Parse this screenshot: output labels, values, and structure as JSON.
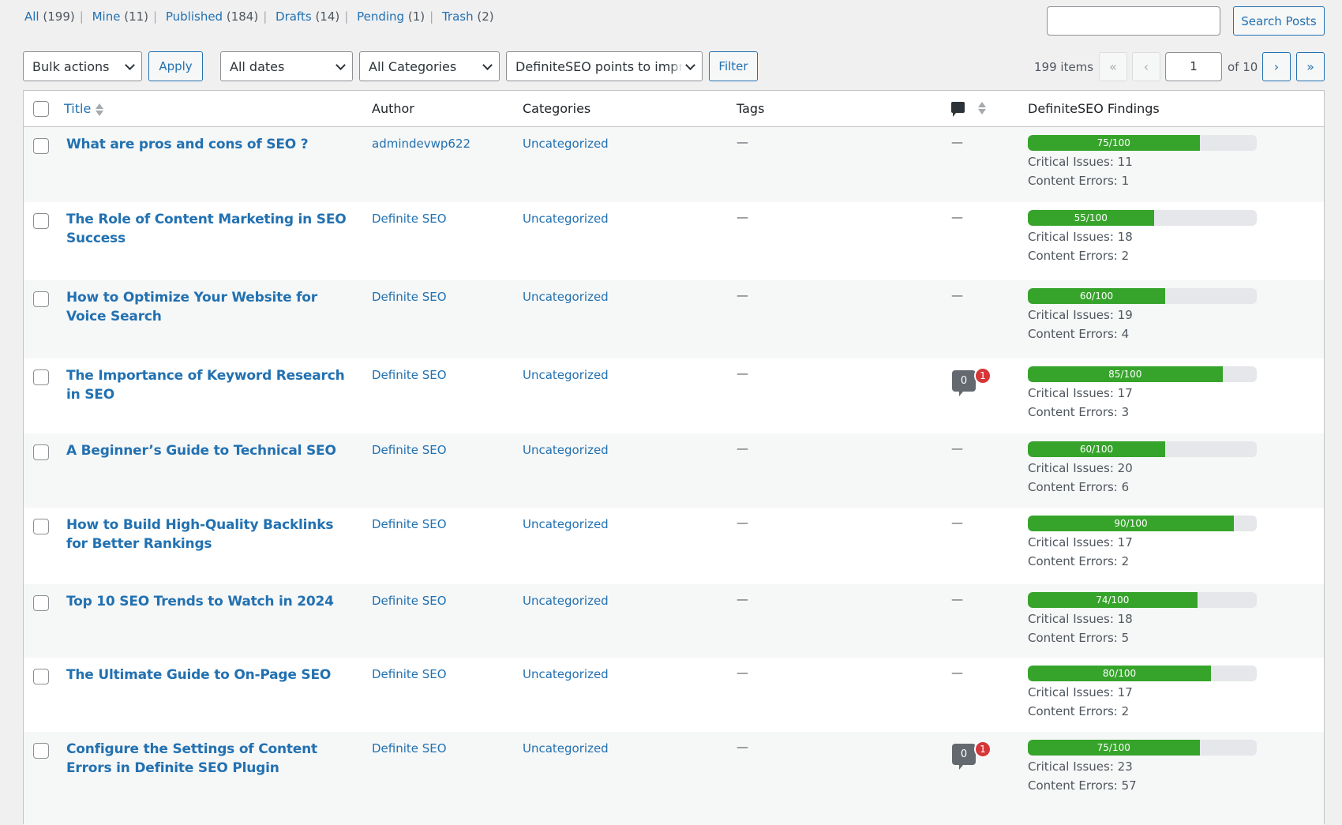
{
  "views": [
    {
      "label": "All",
      "count": "(199)"
    },
    {
      "label": "Mine",
      "count": "(11)"
    },
    {
      "label": "Published",
      "count": "(184)"
    },
    {
      "label": "Drafts",
      "count": "(14)"
    },
    {
      "label": "Pending",
      "count": "(1)"
    },
    {
      "label": "Trash",
      "count": "(2)"
    }
  ],
  "search": {
    "value": "",
    "placeholder": "",
    "button_label": "Search Posts"
  },
  "filters": {
    "bulk_actions": "Bulk actions",
    "apply_label": "Apply",
    "dates": "All dates",
    "categories": "All Categories",
    "seo_filter": "DefiniteSEO points to impr",
    "filter_label": "Filter"
  },
  "pagination": {
    "items": "199 items",
    "first": "«",
    "prev": "‹",
    "current_page": "1",
    "of_total": "of 10",
    "next": "›",
    "last": "»"
  },
  "columns": {
    "title": "Title",
    "author": "Author",
    "categories": "Categories",
    "tags": "Tags",
    "comments_icon": "comment-icon",
    "findings": "DefiniteSEO Findings"
  },
  "colors": {
    "link": "#2271b1",
    "score_fill": "#36a42b",
    "badge": "#d63638"
  },
  "posts": [
    {
      "title": "What are pros and cons of SEO ?",
      "author": "admindevwp622",
      "category": "Uncategorized",
      "tags": "—",
      "comments": null,
      "pending": null,
      "score": 75,
      "score_label": "75/100",
      "critical": "Critical Issues: 11",
      "content": "Content Errors: 1"
    },
    {
      "title": "The Role of Content Marketing in SEO Success",
      "author": "Definite SEO",
      "category": "Uncategorized",
      "tags": "—",
      "comments": null,
      "pending": null,
      "score": 55,
      "score_label": "55/100",
      "critical": "Critical Issues: 18",
      "content": "Content Errors: 2"
    },
    {
      "title": "How to Optimize Your Website for Voice Search",
      "author": "Definite SEO",
      "category": "Uncategorized",
      "tags": "—",
      "comments": null,
      "pending": null,
      "score": 60,
      "score_label": "60/100",
      "critical": "Critical Issues: 19",
      "content": "Content Errors: 4"
    },
    {
      "title": "The Importance of Keyword Research in SEO",
      "author": "Definite SEO",
      "category": "Uncategorized",
      "tags": "—",
      "comments": "0",
      "pending": "1",
      "score": 85,
      "score_label": "85/100",
      "critical": "Critical Issues: 17",
      "content": "Content Errors: 3"
    },
    {
      "title": "A Beginner’s Guide to Technical SEO",
      "author": "Definite SEO",
      "category": "Uncategorized",
      "tags": "—",
      "comments": null,
      "pending": null,
      "score": 60,
      "score_label": "60/100",
      "critical": "Critical Issues: 20",
      "content": "Content Errors: 6"
    },
    {
      "title": "How to Build High-Quality Backlinks for Better Rankings",
      "author": "Definite SEO",
      "category": "Uncategorized",
      "tags": "—",
      "comments": null,
      "pending": null,
      "score": 90,
      "score_label": "90/100",
      "critical": "Critical Issues: 17",
      "content": "Content Errors: 2"
    },
    {
      "title": "Top 10 SEO Trends to Watch in 2024",
      "author": "Definite SEO",
      "category": "Uncategorized",
      "tags": "—",
      "comments": null,
      "pending": null,
      "score": 74,
      "score_label": "74/100",
      "critical": "Critical Issues: 18",
      "content": "Content Errors: 5"
    },
    {
      "title": "The Ultimate Guide to On-Page SEO",
      "author": "Definite SEO",
      "category": "Uncategorized",
      "tags": "—",
      "comments": null,
      "pending": null,
      "score": 80,
      "score_label": "80/100",
      "critical": "Critical Issues: 17",
      "content": "Content Errors: 2"
    },
    {
      "title": "Configure the Settings of Content Errors in Definite SEO Plugin",
      "author": "Definite SEO",
      "category": "Uncategorized",
      "tags": "—",
      "comments": "0",
      "pending": "1",
      "score": 75,
      "score_label": "75/100",
      "critical": "Critical Issues: 23",
      "content": "Content Errors: 57"
    }
  ],
  "no_comments_dash": "—"
}
